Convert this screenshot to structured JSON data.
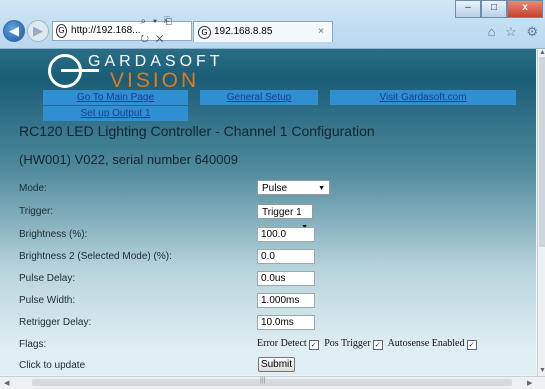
{
  "browser": {
    "address": "http://192.168...",
    "address_controls": "⌕ ▾ ⎗ ↻ ✕",
    "tab_title": "192.168.8.85",
    "tab_close": "×",
    "right_tools": "⌂ ☆ ⚙",
    "window_buttons": {
      "minimize": "–",
      "maximize": "□",
      "close": "x"
    }
  },
  "logo": {
    "top": "GARDASOFT",
    "bottom": "VISION"
  },
  "nav": {
    "main_page": "Go To Main Page",
    "general_setup": "General Setup",
    "visit": "Visit Gardasoft.com",
    "setup_output": "Set up Output 1"
  },
  "page": {
    "title": "RC120 LED Lighting Controller - Channel 1 Configuration",
    "subtitle": "(HW001) V022, serial number 640009"
  },
  "form": {
    "mode_label": "Mode:",
    "mode_value": "Pulse",
    "trigger_label": "Trigger:",
    "trigger_value": "Trigger 1",
    "brightness_label": "Brightness (%):",
    "brightness_value": "100.0",
    "brightness2_label": "Brightness 2 (Selected Mode) (%):",
    "brightness2_value": "0.0",
    "pulse_delay_label": "Pulse Delay:",
    "pulse_delay_value": "0.0us",
    "pulse_width_label": "Pulse Width:",
    "pulse_width_value": "1.000ms",
    "retrigger_label": "Retrigger Delay:",
    "retrigger_value": "10.0ms",
    "flags_label": "Flags:",
    "flag_error": "Error Detect",
    "flag_pos": "Pos Trigger",
    "flag_auto": "Autosense Enabled",
    "update_label": "Click to update",
    "submit_label": "Submit"
  },
  "scroll": {
    "hthumb": "|||"
  }
}
